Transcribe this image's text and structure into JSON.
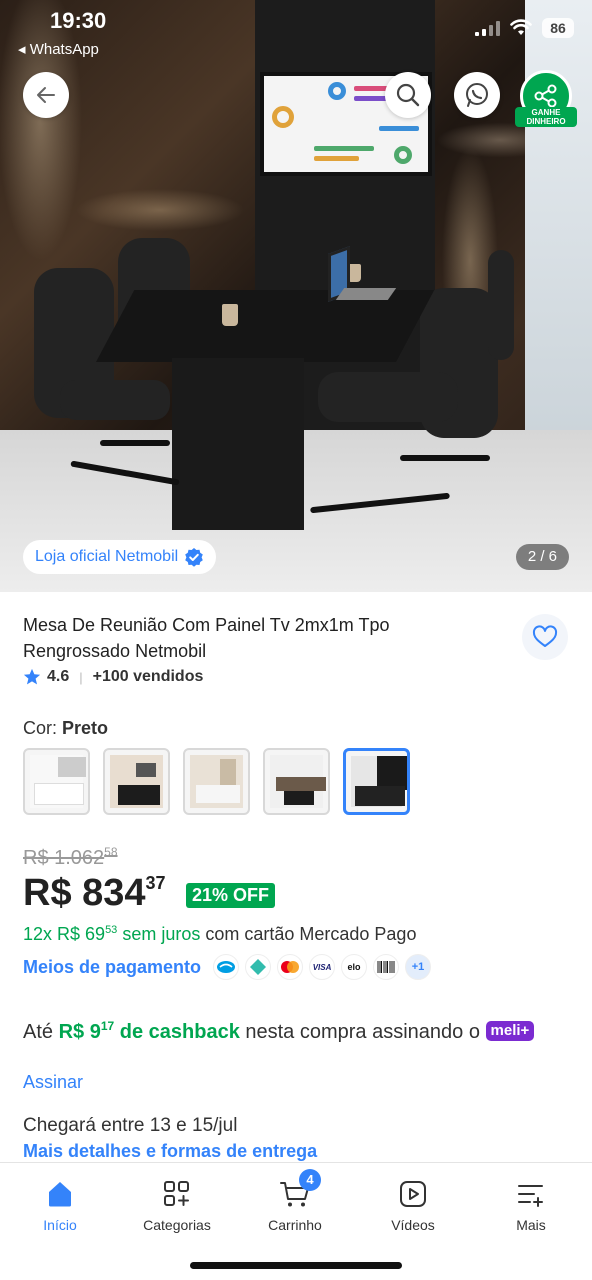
{
  "status_bar": {
    "time": "19:30",
    "back_app": "◂ WhatsApp",
    "battery": "86"
  },
  "hero": {
    "store_badge": "Loja oficial Netmobil",
    "image_counter": "2 / 6",
    "share_label": "GANHE DINHEIRO"
  },
  "product": {
    "title": "Mesa De Reunião Com Painel Tv 2mx1m Tpo Rengrossado Netmobil",
    "rating": "4.6",
    "sold": "+100 vendidos",
    "color_label": "Cor: ",
    "color_value": "Preto",
    "swatches": [
      {
        "name": "white",
        "top": "#ffffff",
        "table": "#f4f4f4"
      },
      {
        "name": "wood-white",
        "top": "#e8ddd0",
        "table": "#1c1c1c"
      },
      {
        "name": "wood-light",
        "top": "#e9e1d6",
        "table": "#f6f6f6"
      },
      {
        "name": "wood-dark",
        "top": "#6b5a4a",
        "table": "#1c1c1c"
      },
      {
        "name": "black",
        "top": "#1a1a1a",
        "table": "#222222"
      }
    ]
  },
  "price": {
    "old_main": "R$ 1.062",
    "old_cents": "58",
    "main": "R$ 834",
    "cents": "37",
    "discount": "21% OFF",
    "installments_green": "12x R$ 69",
    "installments_cents": "53",
    "installments_green2": " sem juros",
    "installments_rest": " com cartão Mercado Pago",
    "payment_link": "Meios de pagamento",
    "payment_icons": [
      "mercadopago-icon",
      "pix-icon",
      "mastercard-icon",
      "visa-icon",
      "elo-icon",
      "boleto-icon"
    ],
    "payment_more": "+1"
  },
  "cashback": {
    "prefix": "Até ",
    "amount": "R$ 9",
    "amount_cents": "17",
    "label": " de cashback",
    "rest": " nesta compra assinando o ",
    "meli_badge": "meli+",
    "subscribe": "Assinar"
  },
  "delivery": {
    "text": "Chegará entre 13 e 15/jul",
    "link": "Mais detalhes e formas de entrega"
  },
  "bottom_nav": {
    "items": [
      {
        "label": "Início",
        "icon": "home-icon"
      },
      {
        "label": "Categorias",
        "icon": "categories-icon"
      },
      {
        "label": "Carrinho",
        "icon": "cart-icon"
      },
      {
        "label": "Vídeos",
        "icon": "video-icon"
      },
      {
        "label": "Mais",
        "icon": "menu-icon"
      }
    ],
    "cart_count": "4"
  },
  "colors": {
    "accent": "#3483fa",
    "green": "#00a650",
    "meli": "#7b2bd1"
  }
}
